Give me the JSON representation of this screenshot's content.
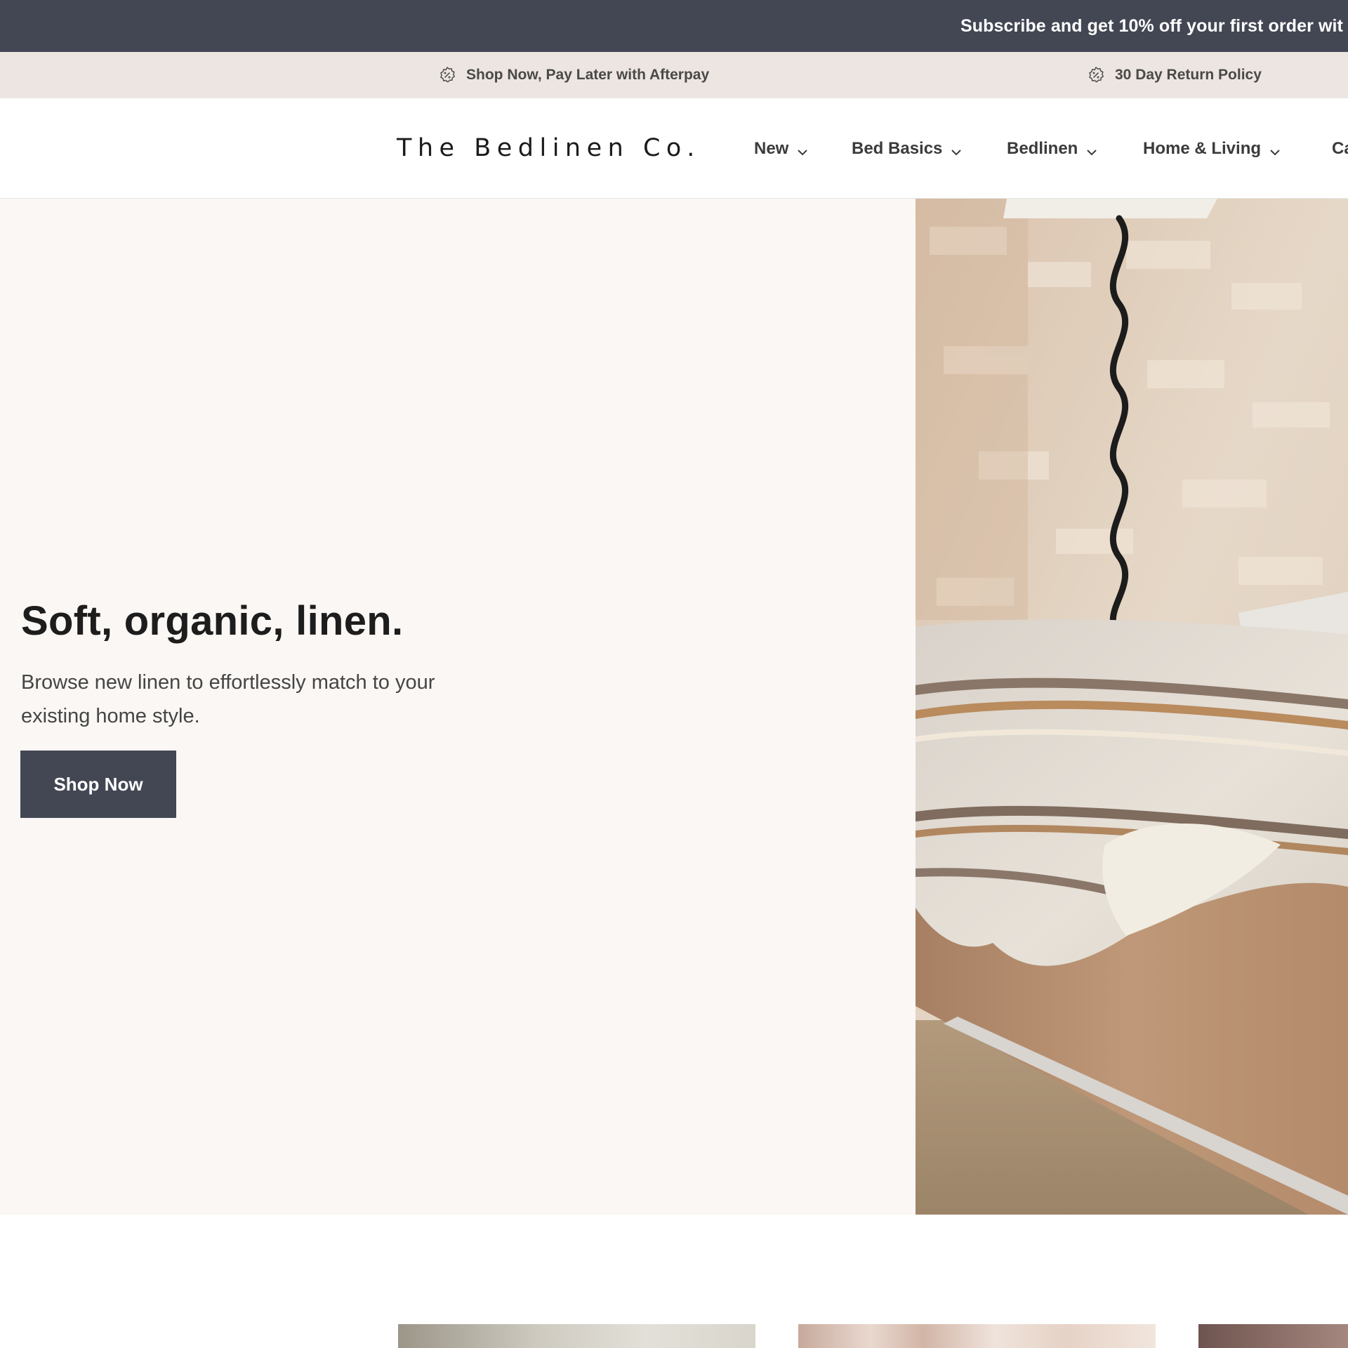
{
  "announcement": {
    "text": "Subscribe and get 10% off your first order wit"
  },
  "usp": {
    "items": [
      {
        "label": "Shop Now, Pay Later with Afterpay",
        "icon": "discount-badge-icon"
      },
      {
        "label": "30 Day Return Policy",
        "icon": "discount-badge-icon"
      }
    ]
  },
  "header": {
    "logo": "The Bedlinen Co.",
    "nav": [
      {
        "label": "New",
        "icon": "chevron-down-icon"
      },
      {
        "label": "Bed Basics",
        "icon": "chevron-down-icon"
      },
      {
        "label": "Bedlinen",
        "icon": "chevron-down-icon"
      },
      {
        "label": "Home & Living",
        "icon": "chevron-down-icon"
      },
      {
        "label": "Ca"
      }
    ]
  },
  "hero": {
    "title": "Soft, organic, linen.",
    "subtitle": "Browse new linen to effortlessly match to your existing home style.",
    "button_label": "Shop Now"
  },
  "colors": {
    "announcement_bg": "#434754",
    "usp_bg": "#ede5e1",
    "hero_bg": "#faf7f4",
    "button_bg": "#434754"
  }
}
